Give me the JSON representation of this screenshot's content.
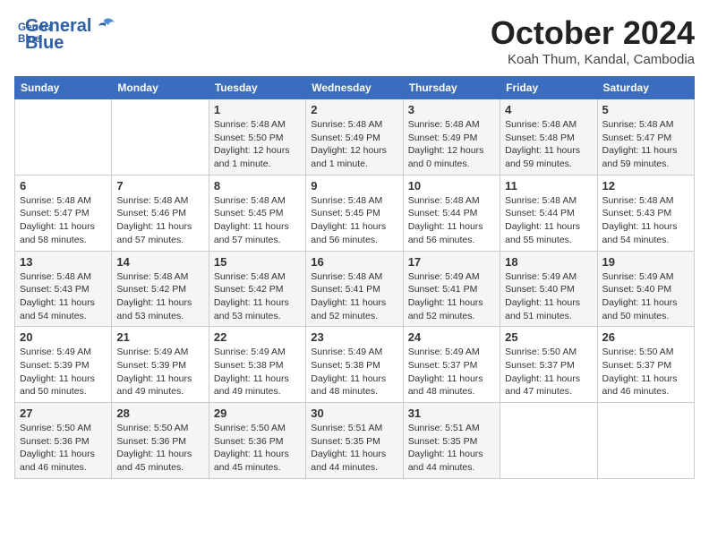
{
  "header": {
    "logo_line1": "General",
    "logo_line2": "Blue",
    "month_title": "October 2024",
    "subtitle": "Koah Thum, Kandal, Cambodia"
  },
  "weekdays": [
    "Sunday",
    "Monday",
    "Tuesday",
    "Wednesday",
    "Thursday",
    "Friday",
    "Saturday"
  ],
  "weeks": [
    [
      {
        "day": "",
        "info": ""
      },
      {
        "day": "",
        "info": ""
      },
      {
        "day": "1",
        "info": "Sunrise: 5:48 AM\nSunset: 5:50 PM\nDaylight: 12 hours and 1 minute."
      },
      {
        "day": "2",
        "info": "Sunrise: 5:48 AM\nSunset: 5:49 PM\nDaylight: 12 hours and 1 minute."
      },
      {
        "day": "3",
        "info": "Sunrise: 5:48 AM\nSunset: 5:49 PM\nDaylight: 12 hours and 0 minutes."
      },
      {
        "day": "4",
        "info": "Sunrise: 5:48 AM\nSunset: 5:48 PM\nDaylight: 11 hours and 59 minutes."
      },
      {
        "day": "5",
        "info": "Sunrise: 5:48 AM\nSunset: 5:47 PM\nDaylight: 11 hours and 59 minutes."
      }
    ],
    [
      {
        "day": "6",
        "info": "Sunrise: 5:48 AM\nSunset: 5:47 PM\nDaylight: 11 hours and 58 minutes."
      },
      {
        "day": "7",
        "info": "Sunrise: 5:48 AM\nSunset: 5:46 PM\nDaylight: 11 hours and 57 minutes."
      },
      {
        "day": "8",
        "info": "Sunrise: 5:48 AM\nSunset: 5:45 PM\nDaylight: 11 hours and 57 minutes."
      },
      {
        "day": "9",
        "info": "Sunrise: 5:48 AM\nSunset: 5:45 PM\nDaylight: 11 hours and 56 minutes."
      },
      {
        "day": "10",
        "info": "Sunrise: 5:48 AM\nSunset: 5:44 PM\nDaylight: 11 hours and 56 minutes."
      },
      {
        "day": "11",
        "info": "Sunrise: 5:48 AM\nSunset: 5:44 PM\nDaylight: 11 hours and 55 minutes."
      },
      {
        "day": "12",
        "info": "Sunrise: 5:48 AM\nSunset: 5:43 PM\nDaylight: 11 hours and 54 minutes."
      }
    ],
    [
      {
        "day": "13",
        "info": "Sunrise: 5:48 AM\nSunset: 5:43 PM\nDaylight: 11 hours and 54 minutes."
      },
      {
        "day": "14",
        "info": "Sunrise: 5:48 AM\nSunset: 5:42 PM\nDaylight: 11 hours and 53 minutes."
      },
      {
        "day": "15",
        "info": "Sunrise: 5:48 AM\nSunset: 5:42 PM\nDaylight: 11 hours and 53 minutes."
      },
      {
        "day": "16",
        "info": "Sunrise: 5:48 AM\nSunset: 5:41 PM\nDaylight: 11 hours and 52 minutes."
      },
      {
        "day": "17",
        "info": "Sunrise: 5:49 AM\nSunset: 5:41 PM\nDaylight: 11 hours and 52 minutes."
      },
      {
        "day": "18",
        "info": "Sunrise: 5:49 AM\nSunset: 5:40 PM\nDaylight: 11 hours and 51 minutes."
      },
      {
        "day": "19",
        "info": "Sunrise: 5:49 AM\nSunset: 5:40 PM\nDaylight: 11 hours and 50 minutes."
      }
    ],
    [
      {
        "day": "20",
        "info": "Sunrise: 5:49 AM\nSunset: 5:39 PM\nDaylight: 11 hours and 50 minutes."
      },
      {
        "day": "21",
        "info": "Sunrise: 5:49 AM\nSunset: 5:39 PM\nDaylight: 11 hours and 49 minutes."
      },
      {
        "day": "22",
        "info": "Sunrise: 5:49 AM\nSunset: 5:38 PM\nDaylight: 11 hours and 49 minutes."
      },
      {
        "day": "23",
        "info": "Sunrise: 5:49 AM\nSunset: 5:38 PM\nDaylight: 11 hours and 48 minutes."
      },
      {
        "day": "24",
        "info": "Sunrise: 5:49 AM\nSunset: 5:37 PM\nDaylight: 11 hours and 48 minutes."
      },
      {
        "day": "25",
        "info": "Sunrise: 5:50 AM\nSunset: 5:37 PM\nDaylight: 11 hours and 47 minutes."
      },
      {
        "day": "26",
        "info": "Sunrise: 5:50 AM\nSunset: 5:37 PM\nDaylight: 11 hours and 46 minutes."
      }
    ],
    [
      {
        "day": "27",
        "info": "Sunrise: 5:50 AM\nSunset: 5:36 PM\nDaylight: 11 hours and 46 minutes."
      },
      {
        "day": "28",
        "info": "Sunrise: 5:50 AM\nSunset: 5:36 PM\nDaylight: 11 hours and 45 minutes."
      },
      {
        "day": "29",
        "info": "Sunrise: 5:50 AM\nSunset: 5:36 PM\nDaylight: 11 hours and 45 minutes."
      },
      {
        "day": "30",
        "info": "Sunrise: 5:51 AM\nSunset: 5:35 PM\nDaylight: 11 hours and 44 minutes."
      },
      {
        "day": "31",
        "info": "Sunrise: 5:51 AM\nSunset: 5:35 PM\nDaylight: 11 hours and 44 minutes."
      },
      {
        "day": "",
        "info": ""
      },
      {
        "day": "",
        "info": ""
      }
    ]
  ]
}
